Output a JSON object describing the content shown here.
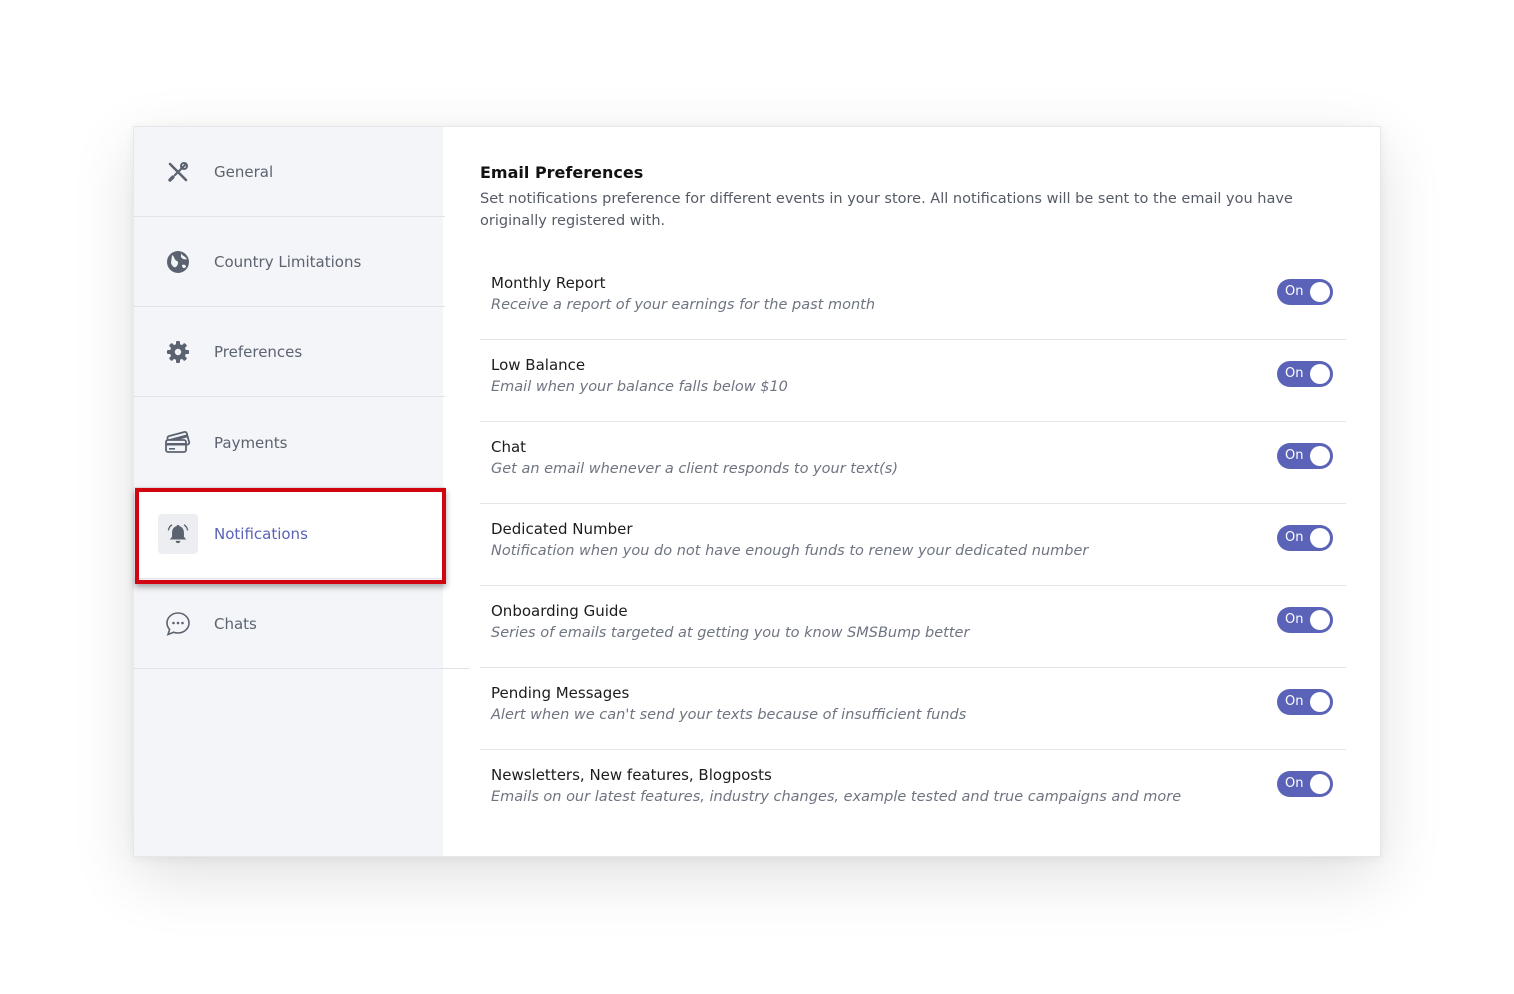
{
  "sidebar": {
    "items": [
      {
        "label": "General",
        "icon": "tools-icon"
      },
      {
        "label": "Country Limitations",
        "icon": "globe-icon"
      },
      {
        "label": "Preferences",
        "icon": "gear-icon"
      },
      {
        "label": "Payments",
        "icon": "credit-cards-icon"
      },
      {
        "label": "Notifications",
        "icon": "bell-icon",
        "active": true
      },
      {
        "label": "Chats",
        "icon": "chat-bubble-icon"
      }
    ]
  },
  "main": {
    "title": "Email Preferences",
    "description": "Set notifications preference for different events in your store. All notifications will be sent to the email you have originally registered with.",
    "preferences": [
      {
        "title": "Monthly Report",
        "subtitle": "Receive a report of your earnings for the past month",
        "toggle": "On"
      },
      {
        "title": "Low Balance",
        "subtitle": "Email when your balance falls below $10",
        "toggle": "On"
      },
      {
        "title": "Chat",
        "subtitle": "Get an email whenever a client responds to your text(s)",
        "toggle": "On"
      },
      {
        "title": "Dedicated Number",
        "subtitle": "Notification when you do not have enough funds to renew your dedicated number",
        "toggle": "On"
      },
      {
        "title": "Onboarding Guide",
        "subtitle": "Series of emails targeted at getting you to know SMSBump better",
        "toggle": "On"
      },
      {
        "title": "Pending Messages",
        "subtitle": "Alert when we can't send your texts because of insufficient funds",
        "toggle": "On"
      },
      {
        "title": "Newsletters, New features, Blogposts",
        "subtitle": "Emails on our latest features, industry changes, example tested and true campaigns and more",
        "toggle": "On"
      }
    ]
  },
  "colors": {
    "accent": "#5a63b8",
    "highlight": "#d0050f",
    "sidebar_bg": "#f4f5f8"
  }
}
